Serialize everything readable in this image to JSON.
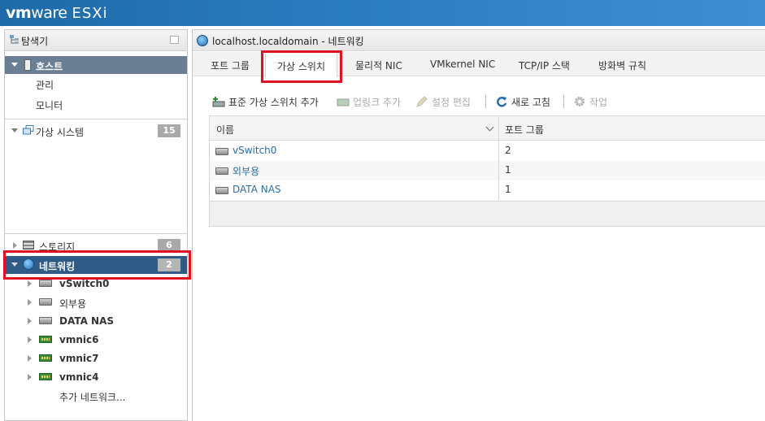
{
  "app": {
    "brand_vm": "vm",
    "brand_ware": "ware",
    "brand_product": "ESXi"
  },
  "navigator": {
    "title": "탐색기",
    "host": {
      "label": "호스트",
      "children": [
        {
          "label": "관리"
        },
        {
          "label": "모니터"
        }
      ]
    },
    "virtual_machines": {
      "label": "가상 시스템",
      "count": "15"
    },
    "storage": {
      "label": "스토리지",
      "count": "6"
    },
    "networking": {
      "label": "네트워킹",
      "count": "2",
      "children": [
        {
          "label": "vSwitch0",
          "icon": "switch-icon"
        },
        {
          "label": "외부용",
          "icon": "switch-icon"
        },
        {
          "label": "DATA NAS",
          "icon": "switch-icon"
        },
        {
          "label": "vmnic6",
          "icon": "nic-icon"
        },
        {
          "label": "vmnic7",
          "icon": "nic-icon"
        },
        {
          "label": "vmnic4",
          "icon": "nic-icon"
        }
      ],
      "more_label": "추가 네트워크..."
    }
  },
  "main": {
    "title": "localhost.localdomain - 네트워킹",
    "tabs": [
      {
        "label": "포트 그룹"
      },
      {
        "label": "가상 스위치",
        "active": true
      },
      {
        "label": "물리적 NIC"
      },
      {
        "label": "VMkernel NIC"
      },
      {
        "label": "TCP/IP 스택"
      },
      {
        "label": "방화벽 규칙"
      }
    ],
    "toolbar": {
      "add_switch": "표준 가상 스위치 추가",
      "add_uplink": "업링크 추가",
      "edit_settings": "설정 편집",
      "refresh": "새로 고침",
      "actions": "작업"
    },
    "table": {
      "columns": [
        "이름",
        "포트 그룹"
      ],
      "rows": [
        {
          "name": "vSwitch0",
          "port_groups": "2"
        },
        {
          "name": "외부용",
          "port_groups": "1"
        },
        {
          "name": "DATA NAS",
          "port_groups": "1"
        }
      ]
    }
  },
  "colors": {
    "topbar": "#2a7cc0",
    "selected": "#2f5b86",
    "highlight": "#e0121f",
    "link": "#2b6ea5"
  }
}
